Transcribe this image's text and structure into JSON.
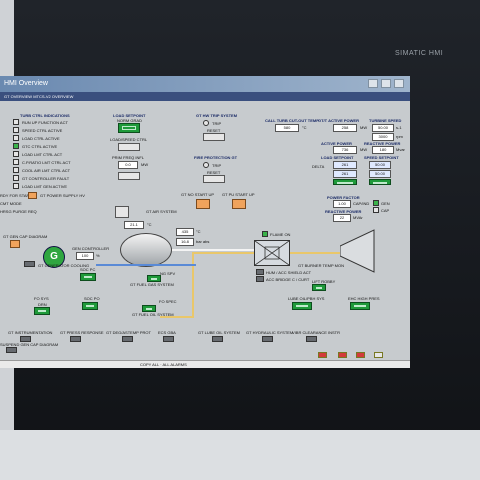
{
  "device": {
    "brand": "SIMATIC HMI"
  },
  "window": {
    "title": "HMI Overview",
    "menu": "GT OVERVIEW   MTCS-V2 OVERVIEW"
  },
  "turb_ctrl": {
    "title": "TURB CTRL INDICATIONS",
    "items": [
      {
        "label": "RUN UP FUNCTION ACT",
        "on": false
      },
      {
        "label": "SPEED CTRL ACTIVE",
        "on": false
      },
      {
        "label": "LOAD CTRL ACTIVE",
        "on": false
      },
      {
        "label": "GTC CTRL ACTIVE",
        "on": true
      },
      {
        "label": "LOAD LMT CTRL ACT",
        "on": false
      },
      {
        "label": "C.P.RATIO LMT CTRL ACT",
        "on": false
      },
      {
        "label": "COOL AIR LMT CTRL ACT",
        "on": false
      },
      {
        "label": "GT CONTROLLER FAULT",
        "on": false
      },
      {
        "label": "LOAD LMT GEN ACTIVE",
        "on": false
      }
    ]
  },
  "load_setpoint": {
    "title": "LOAD SETPOINT",
    "sub": "NORM GRAD",
    "loadspeed": "LOAD/SPEED CTRL"
  },
  "prim_freq": {
    "title": "PRIM FREQ INFL",
    "value": "0.0",
    "unit": "MW"
  },
  "trip": {
    "title": "GT HW TRIP SYSTEM",
    "trip_label": "TRIP",
    "reset_label": "RESET"
  },
  "fire": {
    "title": "FIRE PROTECTION GT",
    "trip_label": "TRIP",
    "reset_label": "RESET"
  },
  "right": {
    "cutout_label": "CALL TURB CUT-OUT TEMP",
    "cutout_value": "580",
    "cutout_unit": "°C",
    "gt_power_label": "GT/T ACTIVE POWER",
    "gt_power_value": "258",
    "gt_power_unit": "MW",
    "turb_speed_label": "TURBINE SPEED",
    "turb_speed_value": "50.00",
    "turb_speed_unit": "s-1",
    "rpm_value": "3000",
    "rpm_unit": "rpm",
    "active_power_label": "ACTIVE POWER",
    "active_power_value": "736",
    "active_power_unit": "MW",
    "reactive_power_label": "REACTIVE POWER",
    "reactive_power_value": "180",
    "reactive_power_unit": "Mvar",
    "load_sp_label": "LOAD SETPOINT",
    "speed_sp_label": "SPEED SETPOINT",
    "delta_label": "DELTA",
    "load_sp_value1": "261",
    "load_sp_value2": "261",
    "speed_sp_value1": "50.00",
    "speed_sp_value2": "50.00",
    "pf_label": "POWER FACTOR",
    "pf_value": "1.00",
    "pf_mode": "CAP/IND",
    "rp_label": "REACTIVE POWER",
    "rp_value": "22",
    "rp_unit": "MVAr",
    "gen_label": "GEN",
    "cap_label": "CAP"
  },
  "left_misc": {
    "ready": "RDY FOR START",
    "cmt": "CMT MODE",
    "heat": "HRSG PURGE REQ"
  },
  "mid": {
    "power_supply": "GT POWER SUPPLY HV",
    "air_system": "GT AIR SYSTEM",
    "start_up1": "GT NO START UP",
    "start_up2": "GT PU START UP",
    "flame_on": "FLAME ON",
    "burner_temp": "GT BURNER TEMP MON",
    "gen_cap": "GT GEN CAP DIAGRAM",
    "gen_letter": "G",
    "gen_controller": "GEN CONTROLLER",
    "gen_pct": "100",
    "gen_pct_unit": "%",
    "gen_cooling": "GT GENERATOR COOLING",
    "temp_value": "21.1",
    "temp_unit": "°C",
    "val_a": "435",
    "val_a_unit": "°C",
    "val_b": "16.8",
    "val_b_unit": "bar abs",
    "hum": "HUM / ACC SHIELD ACT",
    "acc": "ACC BRIDGE C / CURT",
    "lift_label": "LIFT ROBBY",
    "fuel_gas": "GT FUEL GAS SYSTEM",
    "fuel_oil": "GT FUEL OIL SYSTEM",
    "lube_oil": "LUBE OIL/PBH SYS",
    "ehc": "EHC HIGH PRES",
    "oil_sys": "GT OIL SYS",
    "soc": "SOC PC",
    "soc2": "SOC PO",
    "eco": "SOC SPC",
    "fo_label": "FO SYS",
    "drn_label": "DRN",
    "ng_label": "NG SPV",
    "fo_inj": "FO INJECTION",
    "fo_xk": "FO SPEC",
    "fuel_env": "FU ENVS"
  },
  "bottom": [
    "GT INSTRUMENTATION",
    "GT PRESS RESPONSE",
    "GT DEG/ASTEMP PROT",
    "ECS GBA",
    "GT LUBE OIL SYSTEM",
    "GT HYDRAULIC SYSTEM",
    "VIBR CLEARANCE INSTR"
  ],
  "bottom_extra": "SUSPEND GEN CAP DIAGRAM",
  "taskbar": {
    "center": "COPY ALL  ·  ALL ALARMS"
  }
}
